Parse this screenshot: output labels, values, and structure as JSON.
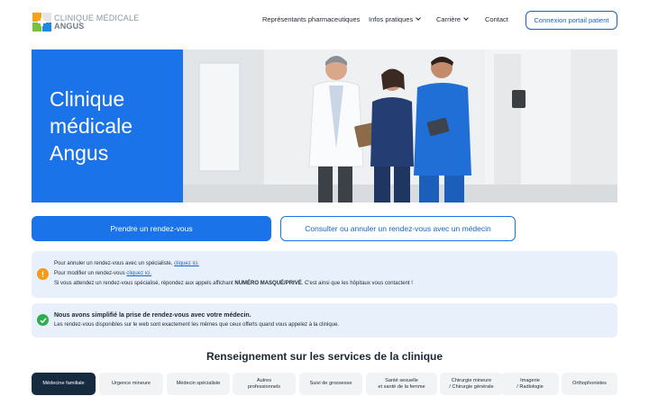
{
  "header": {
    "logo_line1": "CLINIQUE MÉDICALE",
    "logo_line2": "ANGUS",
    "nav": [
      {
        "label": "Représentants pharmaceutiques",
        "has_dropdown": false
      },
      {
        "label": "Infos pratiques",
        "has_dropdown": true
      },
      {
        "label": "Carrière",
        "has_dropdown": true
      },
      {
        "label": "Contact",
        "has_dropdown": false
      }
    ],
    "portal_button": "Connexion portail patient"
  },
  "hero": {
    "title": "Clinique médicale Angus",
    "image": "medical-staff-photo"
  },
  "actions": {
    "primary": "Prendre un rendez-vous",
    "secondary": "Consulter ou annuler un rendez-vous avec un médecin"
  },
  "alert_info": {
    "icon": "warning-icon",
    "line1_text": "Pour annuler un rendez-vous avec un spécialiste,",
    "line1_link": "cliquez ici.",
    "line2_text": "Pour modifier un rendez-vous",
    "line2_link": "cliquez ici.",
    "line3_pre": "Si vous attendez un rendez-vous spécialisé, répondez aux appels affichant",
    "line3_strong": "NUMÉRO MASQUÉ/PRIVÉ",
    "line3_post": ". C'est ainsi que les hôpitaux vous contactent !"
  },
  "alert_success": {
    "icon": "check-icon",
    "title": "Nous avons simplifié la prise de rendez-vous avec votre médecin.",
    "body": "Les rendez-vous disponibles sur le web sont exactement les mêmes que ceux offerts quand vous appelez à la clinique."
  },
  "services": {
    "title": "Renseignement sur les services de la clinique",
    "tabs": [
      {
        "label": "Médecine familiale",
        "active": true
      },
      {
        "label": "Urgence mineure",
        "active": false
      },
      {
        "label": "Médecin spécialiste",
        "active": false
      },
      {
        "label": "Autres\nprofessionnels",
        "active": false
      },
      {
        "label": "Suivi de grossesse",
        "active": false
      },
      {
        "label": "Santé sexuelle\net santé de la femme",
        "active": false
      },
      {
        "label": "Chirurgie mineure\n/ Chirurgie générale",
        "active": false
      },
      {
        "label": "Imagerie\n/ Radiologie",
        "active": false
      },
      {
        "label": "Orthophonistes",
        "active": false
      }
    ]
  },
  "colors": {
    "brand_blue": "#1a73e8",
    "dark_navy": "#162a40",
    "alert_bg": "#e8f0fb",
    "warning": "#f59a1b",
    "success": "#2eae4f"
  }
}
